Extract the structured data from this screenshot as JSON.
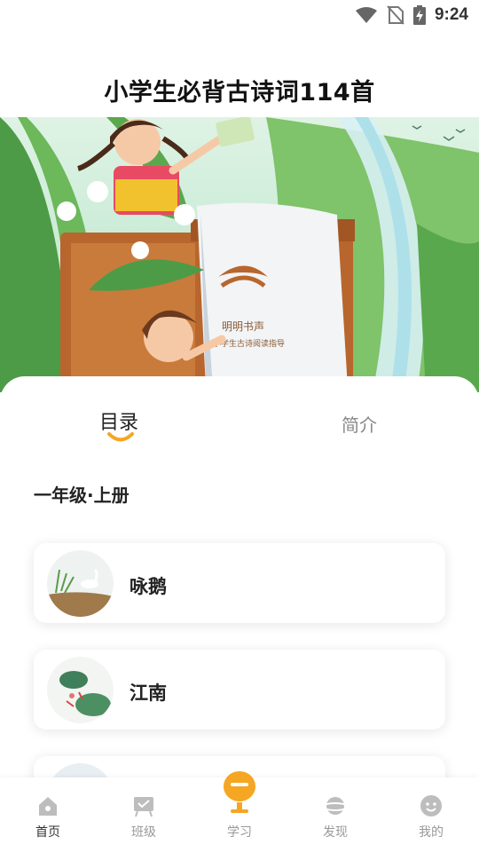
{
  "status_bar": {
    "time": "9:24"
  },
  "header": {
    "title": "小学生必背古诗词114首"
  },
  "banner": {
    "book_label": "明明书声",
    "book_sub": "小学生古诗阅读指导"
  },
  "tabs": [
    {
      "label": "目录",
      "active": true
    },
    {
      "label": "简介",
      "active": false
    }
  ],
  "section": {
    "title": "一年级·上册"
  },
  "poems": [
    {
      "title": "咏鹅"
    },
    {
      "title": "江南"
    },
    {
      "title": ""
    }
  ],
  "bottom_nav": [
    {
      "label": "首页",
      "icon": "home-icon",
      "active": true
    },
    {
      "label": "班级",
      "icon": "class-icon",
      "active": false
    },
    {
      "label": "学习",
      "icon": "microphone-icon",
      "active": false
    },
    {
      "label": "发现",
      "icon": "planet-icon",
      "active": false
    },
    {
      "label": "我的",
      "icon": "smile-face-icon",
      "active": false
    }
  ],
  "colors": {
    "accent": "#f5a623",
    "nav_inactive": "#bbbbbb",
    "title": "#111111"
  }
}
